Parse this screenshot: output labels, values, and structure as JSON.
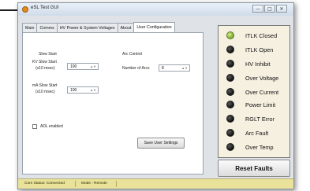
{
  "window": {
    "title": "eSL Test GUI",
    "buttons": [
      "—",
      "□",
      "✕"
    ]
  },
  "tabs": [
    "Main",
    "Comms",
    "HV Power & System Voltages",
    "About",
    "User Configuration"
  ],
  "active_tab": "User Configuration",
  "user_config": {
    "slow_start_title": "Slow Start",
    "kv_label": "KV Slow Start",
    "kv_unit": "(x10 msec)",
    "kv_value": "100",
    "ma_label": "mA Slow Start",
    "ma_unit": "(x10 msec)",
    "ma_value": "100",
    "arc_title": "Arc Control",
    "arcs_label": "Number of Arcs",
    "arcs_value": "8",
    "adl_label": "ADL enabled",
    "adl_checked": false,
    "save_label": "Save User Settings"
  },
  "indicators": [
    {
      "label": "ITLK Closed",
      "on": true
    },
    {
      "label": "ITLK Open",
      "on": false
    },
    {
      "label": "HV Inhibit",
      "on": false
    },
    {
      "label": "Over Voltage",
      "on": false
    },
    {
      "label": "Over Current",
      "on": false
    },
    {
      "label": "Power Limit",
      "on": false
    },
    {
      "label": "RGLT Error",
      "on": false
    },
    {
      "label": "Arc Fault",
      "on": false
    },
    {
      "label": "Over Temp",
      "on": false
    }
  ],
  "reset_label": "Reset Faults",
  "status_bar": {
    "comm": "Com Status: Connected",
    "mode": "Mode : Remote"
  },
  "colors": {
    "led_on": "#8fbf3a",
    "led_off": "#1a1a1a",
    "status_panel": "#f5f0e0",
    "status_bar": "#e9e29a"
  }
}
